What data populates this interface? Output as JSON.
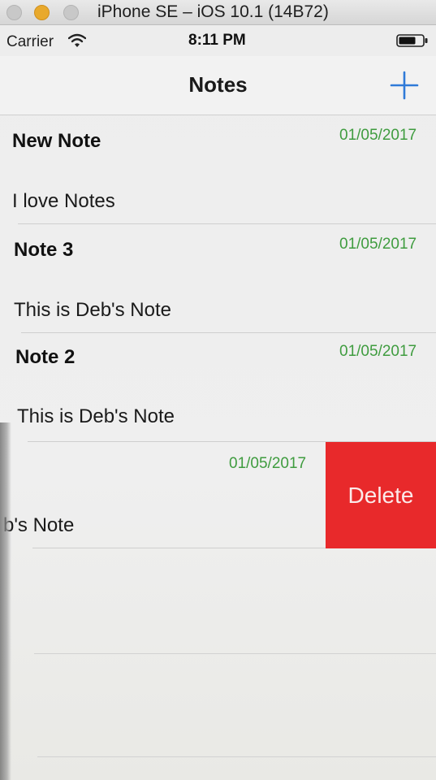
{
  "simulator": {
    "title": "iPhone SE – iOS 10.1 (14B72)"
  },
  "status_bar": {
    "carrier": "Carrier",
    "time": "8:11 PM",
    "icons": [
      "wifi-icon",
      "battery-icon"
    ]
  },
  "nav": {
    "title": "Notes",
    "add_icon": "plus-icon"
  },
  "notes": [
    {
      "title": "New Note",
      "date": "01/05/2017",
      "body": "I love Notes"
    },
    {
      "title": "Note 3",
      "date": "01/05/2017",
      "body": "This is Deb's Note"
    },
    {
      "title": "Note 2",
      "date": "01/05/2017",
      "body": "This is Deb's Note"
    },
    {
      "title": "",
      "date": "01/05/2017",
      "body": "b's Note"
    }
  ],
  "swipe_action": {
    "label": "Delete",
    "color": "#e8292b"
  },
  "colors": {
    "accent": "#2f7ad8",
    "date": "#3f9c3f"
  }
}
